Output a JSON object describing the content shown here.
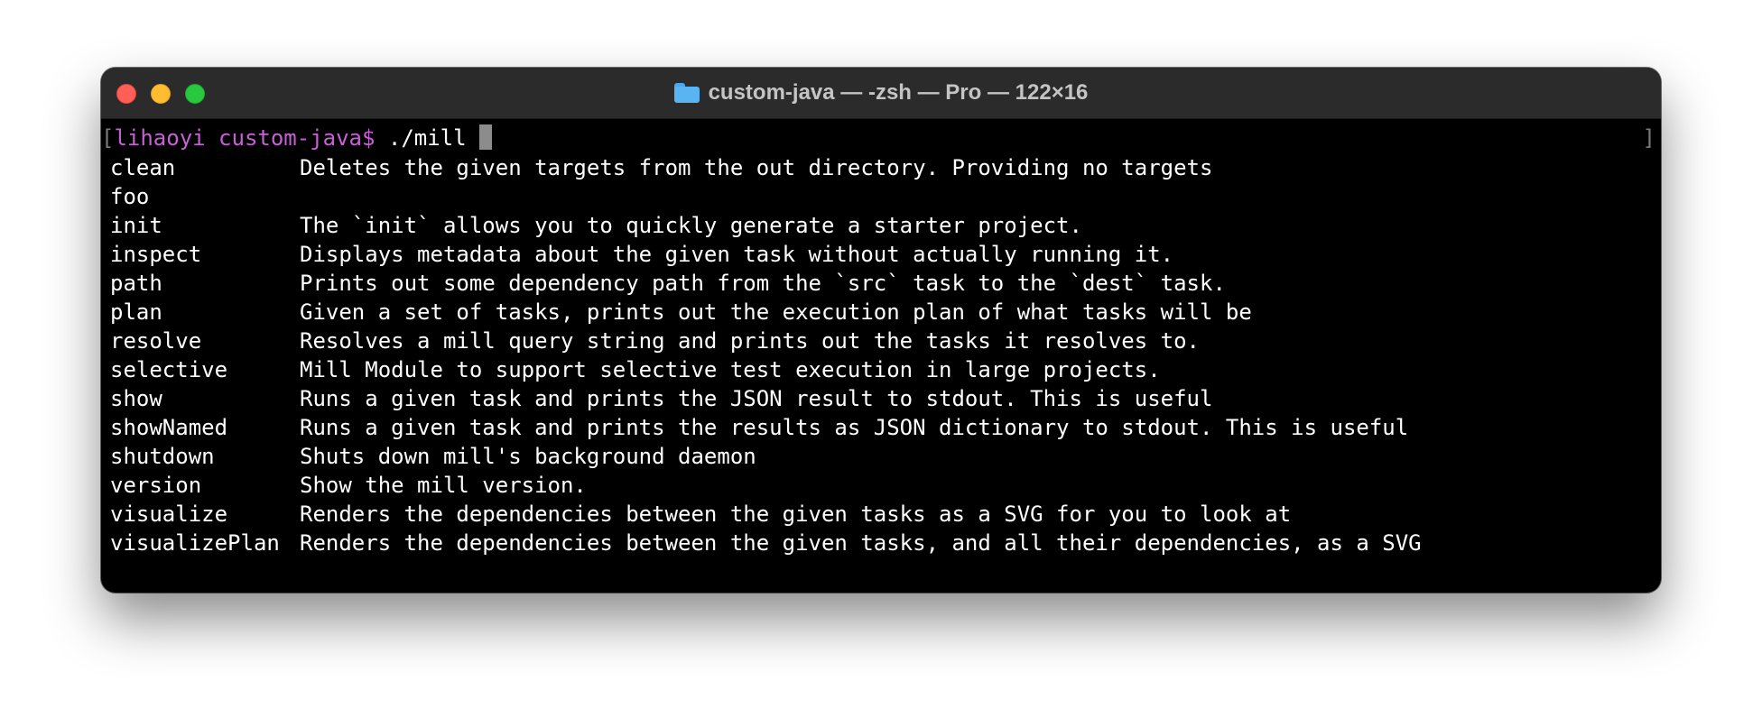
{
  "window": {
    "title": "custom-java — -zsh — Pro — 122×16",
    "folder_icon": "folder-icon",
    "traffic_lights": {
      "close": "#ff5f57",
      "minimize": "#febc2e",
      "maximize": "#28c840"
    }
  },
  "terminal": {
    "bracket_left": "[",
    "bracket_right": "]",
    "prompt": "lihaoyi custom-java$",
    "command": " ./mill ",
    "prompt_color": "#c760d5",
    "rows": [
      {
        "cmd": "clean",
        "desc": "Deletes the given targets from the out directory. Providing no targets"
      },
      {
        "cmd": "foo",
        "desc": ""
      },
      {
        "cmd": "init",
        "desc": "The `init` allows you to quickly generate a starter project."
      },
      {
        "cmd": "inspect",
        "desc": "Displays metadata about the given task without actually running it."
      },
      {
        "cmd": "path",
        "desc": "Prints out some dependency path from the `src` task to the `dest` task."
      },
      {
        "cmd": "plan",
        "desc": "Given a set of tasks, prints out the execution plan of what tasks will be"
      },
      {
        "cmd": "resolve",
        "desc": "Resolves a mill query string and prints out the tasks it resolves to."
      },
      {
        "cmd": "selective",
        "desc": "Mill Module to support selective test execution in large projects."
      },
      {
        "cmd": "show",
        "desc": "Runs a given task and prints the JSON result to stdout. This is useful"
      },
      {
        "cmd": "showNamed",
        "desc": "Runs a given task and prints the results as JSON dictionary to stdout. This is useful"
      },
      {
        "cmd": "shutdown",
        "desc": "Shuts down mill's background daemon"
      },
      {
        "cmd": "version",
        "desc": "Show the mill version."
      },
      {
        "cmd": "visualize",
        "desc": "Renders the dependencies between the given tasks as a SVG for you to look at"
      },
      {
        "cmd": "visualizePlan",
        "desc": "Renders the dependencies between the given tasks, and all their dependencies, as a SVG"
      }
    ]
  }
}
